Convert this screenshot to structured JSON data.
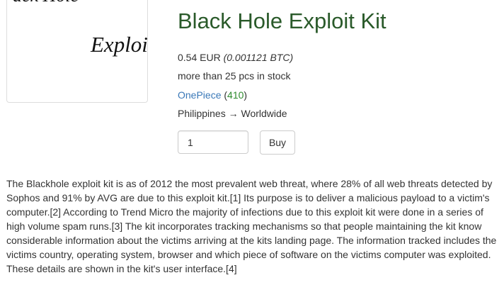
{
  "product": {
    "image_text_top": "ack Hole",
    "image_text_main": "Exploi",
    "title": "Black Hole Exploit Kit",
    "price_eur": "0.54 EUR",
    "price_btc": "(0.001121 BTC)",
    "stock": "more than 25 pcs in stock",
    "vendor_name": "OnePiece",
    "vendor_rating": "410",
    "shipping": "Philippines → Worldwide",
    "quantity_value": "1",
    "buy_label": "Buy",
    "description": "The Blackhole exploit kit is as of 2012 the most prevalent web threat, where 28% of all web threats detected by Sophos and 91% by AVG are due to this exploit kit.[1] Its purpose is to deliver a malicious payload to a victim's computer.[2] According to Trend Micro the majority of infections due to this exploit kit were done in a series of high volume spam runs.[3] The kit incorporates tracking mechanisms so that people maintaining the kit know considerable information about the victims arriving at the kits landing page. The information tracked includes the victims country, operating system, browser and which piece of software on the victims computer was exploited. These details are shown in the kit's user interface.[4]"
  },
  "colors": {
    "title": "#2a5a2a",
    "link": "#3a78b8",
    "rating": "#2e8b2e",
    "text": "#333333"
  }
}
